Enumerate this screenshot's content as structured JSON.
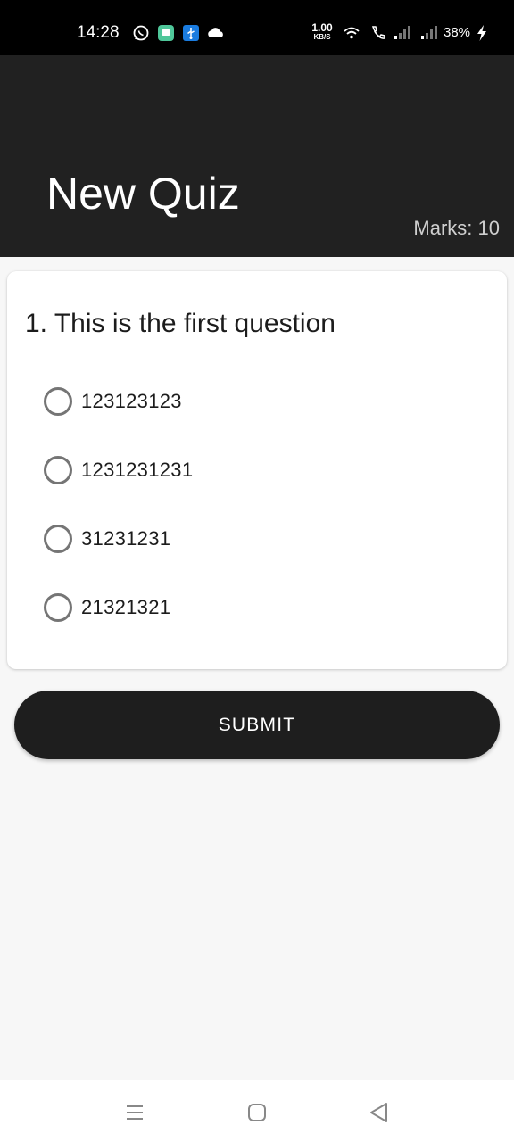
{
  "status_bar": {
    "time": "14:28",
    "net_speed_value": "1.00",
    "net_speed_unit": "KB/S",
    "battery": "38%",
    "icons": [
      "whatsapp-icon",
      "messages-icon",
      "usb-icon",
      "cloud-icon",
      "wifi-icon",
      "call-icon",
      "signal-icon",
      "signal-icon",
      "charging-icon"
    ]
  },
  "app_bar": {
    "title": "New Quiz",
    "marks": "Marks: 10"
  },
  "question": {
    "text": "1. This is the first question",
    "options": [
      "123123123",
      "1231231231",
      "31231231",
      "21321321"
    ],
    "selected": null
  },
  "submit": {
    "label": "SUBMIT"
  },
  "nav_bar": {
    "icons": [
      "recents-icon",
      "home-icon",
      "back-icon"
    ]
  },
  "colors": {
    "app_bar": "#212121",
    "button": "#1e1e1e",
    "background": "#f7f7f7",
    "radio_border": "#757575"
  }
}
